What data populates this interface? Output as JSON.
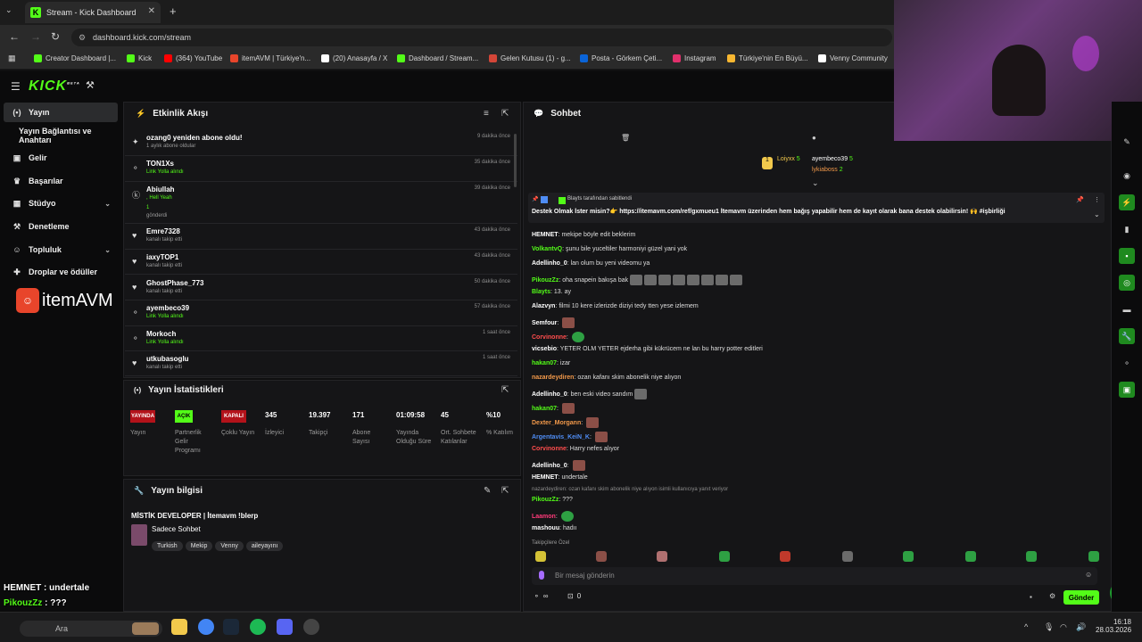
{
  "browser": {
    "tab_title": "Stream - Kick Dashboard",
    "url": "dashboard.kick.com/stream",
    "bookmarks": [
      {
        "label": "Creator Dashboard |...",
        "color": "#53fc18"
      },
      {
        "label": "Kick",
        "color": "#53fc18"
      },
      {
        "label": "(364) YouTube",
        "color": "#ff0000"
      },
      {
        "label": "itemAVM | Türkiye'n...",
        "color": "#e8452b"
      },
      {
        "label": "(20) Anasayfa / X",
        "color": "#ffffff"
      },
      {
        "label": "Dashboard / Stream...",
        "color": "#53fc18"
      },
      {
        "label": "Gelen Kutusu (1) - g...",
        "color": "#d44638"
      },
      {
        "label": "Posta - Görkem Çeti...",
        "color": "#0a64d8"
      },
      {
        "label": "Instagram",
        "color": "#e1306c"
      },
      {
        "label": "Türkiye'nin En Büyü...",
        "color": "#f7b731"
      },
      {
        "label": "Venny Community",
        "color": "#ffffff"
      }
    ]
  },
  "kick": {
    "logo": "KICK",
    "beta": "BETA"
  },
  "sidebar": {
    "items": [
      {
        "label": "Yayın",
        "icon": "broadcast-icon"
      },
      {
        "label": "Yayın Bağlantısı ve Anahtarı",
        "icon": ""
      },
      {
        "label": "Gelir",
        "icon": "wallet-icon"
      },
      {
        "label": "Başarılar",
        "icon": "trophy-icon"
      },
      {
        "label": "Stüdyo",
        "icon": "studio-icon"
      },
      {
        "label": "Denetleme",
        "icon": "hammer-icon"
      },
      {
        "label": "Topluluk",
        "icon": "community-icon"
      },
      {
        "label": "Droplar ve ödüller",
        "icon": "gift-icon"
      }
    ],
    "sponsor": "itemAVM"
  },
  "activity": {
    "title": "Etkinlik Akışı",
    "rows": [
      {
        "name": "ozang0 yeniden abone oldu!",
        "sub": "1 aylık abone oldular",
        "sub2": "",
        "time": "9 dakika önce",
        "green": false,
        "icon": "star-icon"
      },
      {
        "name": "TON1Xs",
        "sub": "Link Yolla alındı",
        "sub2": "",
        "time": "35 dakika önce",
        "green": true,
        "icon": "reward-icon"
      },
      {
        "name": "Abiullah",
        "sub": ", Hell Yeah",
        "sub2": "1",
        "sub3": "gönderdi",
        "time": "39 dakika önce",
        "green": true,
        "icon": "kick-icon"
      },
      {
        "name": "Emre7328",
        "sub": "kanalı takip etti",
        "sub2": "",
        "time": "43 dakika önce",
        "green": false,
        "icon": "heart-icon"
      },
      {
        "name": "iaxyTOP1",
        "sub": "kanalı takip etti",
        "sub2": "",
        "time": "43 dakika önce",
        "green": false,
        "icon": "heart-icon"
      },
      {
        "name": "GhostPhase_773",
        "sub": "kanalı takip etti",
        "sub2": "",
        "time": "50 dakika önce",
        "green": false,
        "icon": "heart-icon"
      },
      {
        "name": "ayembeco39",
        "sub": "Link Yolla alındı",
        "sub2": "",
        "time": "57 dakika önce",
        "green": true,
        "icon": "reward-icon"
      },
      {
        "name": "Morkoch",
        "sub": "Link Yolla alındı",
        "sub2": "",
        "time": "1 saat önce",
        "green": true,
        "icon": "reward-icon"
      },
      {
        "name": "utkubasoglu",
        "sub": "kanalı takip etti",
        "sub2": "",
        "time": "1 saat önce",
        "green": false,
        "icon": "heart-icon"
      }
    ]
  },
  "stats": {
    "title": "Yayın İstatistikleri",
    "badges": [
      {
        "text": "YAYINDA",
        "color": "#b3121a",
        "label": "Yayın"
      },
      {
        "text": "AÇIK",
        "color": "#53fc18",
        "label": "Partnerlik Gelir Programı"
      },
      {
        "text": "KAPALI",
        "color": "#b3121a",
        "label": "Çoklu Yayın"
      }
    ],
    "values": [
      {
        "value": "345",
        "label": "İzleyici"
      },
      {
        "value": "19.397",
        "label": "Takipçi"
      },
      {
        "value": "171",
        "label": "Abone Sayısı"
      },
      {
        "value": "01:09:58",
        "label": "Yayında Olduğu Süre"
      },
      {
        "value": "45",
        "label": "Ort. Sohbete Katılanlar"
      },
      {
        "value": "%10",
        "label": "% Katılım"
      }
    ]
  },
  "info": {
    "title": "Yayın bilgisi",
    "stream_title": "MİSTİK DEVELOPER | İtemavm !blerp",
    "category": "Sadece Sohbet",
    "tags": [
      "Turkish",
      "Mekip",
      "Venny",
      "aileyayını"
    ]
  },
  "chat": {
    "title": "Sohbet",
    "leaderboard": [
      {
        "name": "Loiyxx",
        "count": "5",
        "color": "#f2c94c"
      },
      {
        "name": "ayembeco39",
        "count": "5",
        "color": "#ffffff"
      },
      {
        "name": "lykiaboss",
        "count": "2",
        "color": "#f2994a"
      }
    ],
    "pinned_by": "Blayts tarafından sabitlendi",
    "pinned_text": "Destek Olmak İster misin?👉 https://itemavm.com/ref/gxmueu1 İtemavm üzerinden hem bağış yapabilir hem de kayıt olarak bana destek olabilirsin! 🙌 #işbirliği",
    "messages": [
      {
        "user": "HEMNET",
        "color": "#ffffff",
        "text": "mekipe böyle edit beklerim"
      },
      {
        "user": "VolkantvQ",
        "color": "#53fc18",
        "text": "şunu bile yuceltiler harmoniyi güzel yani yok"
      },
      {
        "user": "Adellinho_0",
        "color": "#ffffff",
        "text": "lan olum bu yeni videomu ya"
      },
      {
        "user": "PikouzZz",
        "color": "#53fc18",
        "text": "oha snapein bakışa bak"
      },
      {
        "user": "Blayts",
        "color": "#53fc18",
        "text": "13. ay"
      },
      {
        "user": "Alazvyn",
        "color": "#ffffff",
        "text": "filmi 10 kere izlerizde diziyi tedy tten yese izlemem"
      },
      {
        "user": "Semfour",
        "color": "#ffffff",
        "text": ""
      },
      {
        "user": "Corvinonne",
        "color": "#ff4d4d",
        "text": ""
      },
      {
        "user": "vicsebio",
        "color": "#ffffff",
        "text": "YETER OLM YETER ejderha gibi kükrücem ne lan bu harry potter editleri"
      },
      {
        "user": "hakan07",
        "color": "#53fc18",
        "text": "izar"
      },
      {
        "user": "nazardeydiren",
        "color": "#f2994a",
        "text": "ozan kafanı skim abonelik niye alıyon"
      },
      {
        "user": "Adellinho_0",
        "color": "#ffffff",
        "text": "ben eski video sandım"
      },
      {
        "user": "hakan07",
        "color": "#53fc18",
        "text": ""
      },
      {
        "user": "Dexter_Morgann",
        "color": "#f2994a",
        "text": ""
      },
      {
        "user": "Argentavis_KeiN_K",
        "color": "#4f8df5",
        "text": ""
      },
      {
        "user": "Corvinonne",
        "color": "#ff4d4d",
        "text": "Harry nefes alıyor"
      },
      {
        "user": "Adellinho_0",
        "color": "#ffffff",
        "text": ""
      },
      {
        "user": "HEMNET",
        "color": "#ffffff",
        "text": "undertale"
      },
      {
        "user": "PikouzZz",
        "color": "#53fc18",
        "text": "???"
      },
      {
        "user": "Laamon",
        "color": "#ff3a7a",
        "text": ""
      },
      {
        "user": "mashouu",
        "color": "#ffffff",
        "text": "hadıı"
      }
    ],
    "reply_note": "nazardeydiren: ozan kafanı skim abonelik niye alıyon isimli kullanıcıya yanıt veriyor",
    "followers_only": "Takipçilere Özel",
    "input_placeholder": "Bir mesaj gönderin",
    "send": "Gönder",
    "points": "∞",
    "count": "0"
  },
  "overlay": [
    {
      "user": "HEMNET",
      "color": "#ffffff",
      "text": " : undertale"
    },
    {
      "user": "PikouzZz",
      "color": "#53fc18",
      "text": " : ???"
    },
    {
      "user": "Laamon",
      "color": "#ff3a7a",
      "text": " : "
    },
    {
      "user": "mashouu",
      "color": "#ffffff",
      "text": " : hadıı"
    }
  ],
  "taskbar": {
    "search": "Ara",
    "time": "16:18",
    "date": "28.03.2026"
  }
}
